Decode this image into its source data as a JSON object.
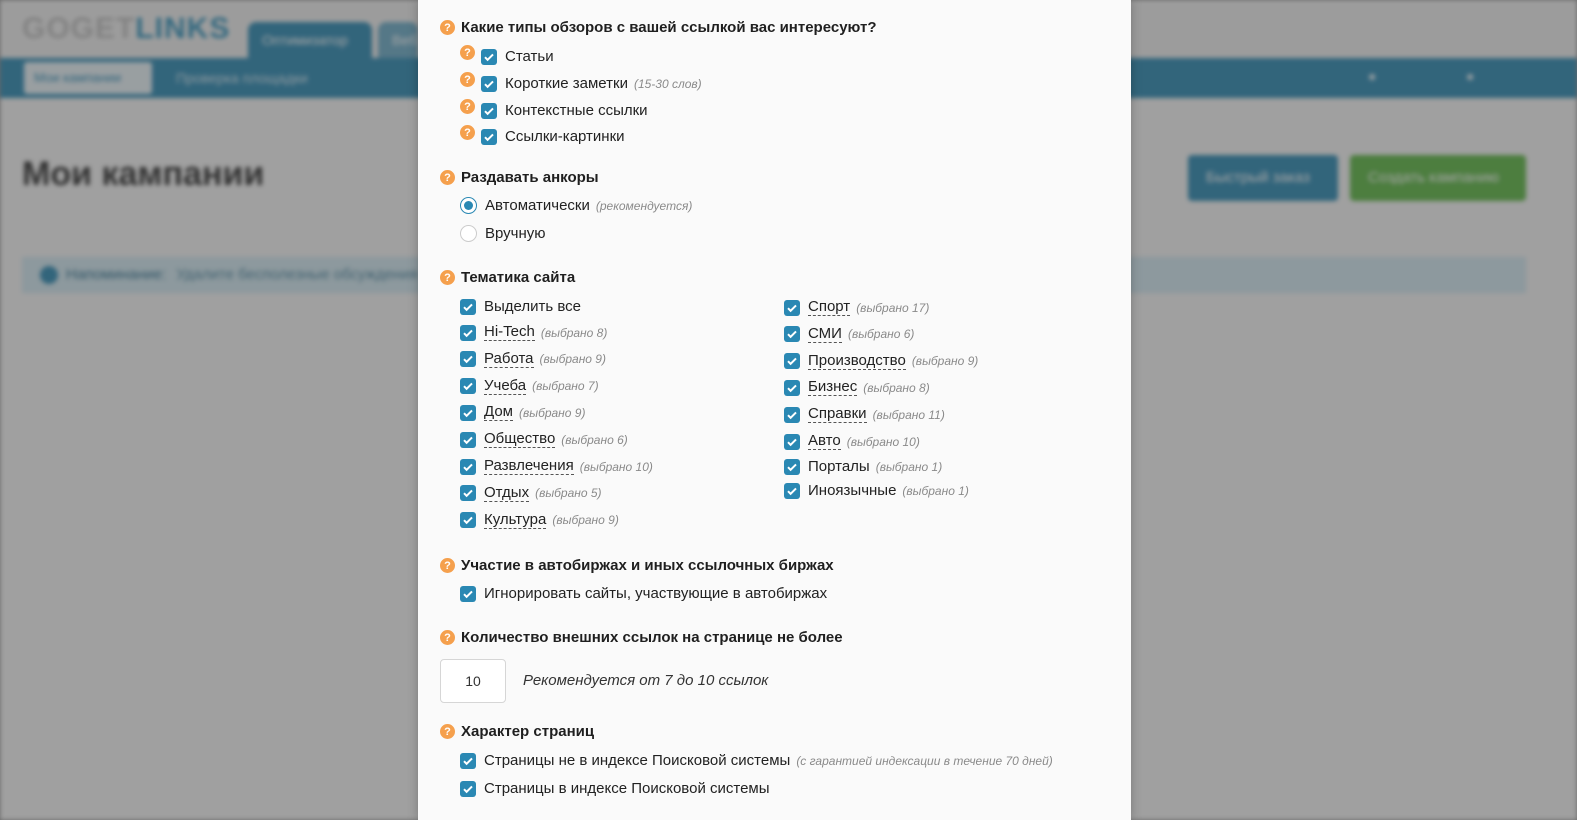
{
  "background": {
    "logo_pre": "GOGET",
    "logo_hl": "LINKS",
    "tab_active": "Оптимизатор",
    "tab_second": "Веб",
    "nav_button": "Мои кампании",
    "nav_link": "Проверка площадки",
    "page_title": "Мои кампании",
    "btn_fast": "Быстрый заказ",
    "btn_create": "Создать кампанию",
    "notice_label": "Напоминание:",
    "notice_text": "Удалите бесполезные обсуждения"
  },
  "modal": {
    "review_types": {
      "title": "Какие типы обзоров с вашей ссылкой вас интересуют?",
      "items": [
        {
          "label": "Статьи",
          "note": ""
        },
        {
          "label": "Короткие заметки",
          "note": "(15-30 слов)"
        },
        {
          "label": "Контекстные ссылки",
          "note": ""
        },
        {
          "label": "Ссылки-картинки",
          "note": ""
        }
      ]
    },
    "anchors": {
      "title": "Раздавать анкоры",
      "auto_label": "Автоматически",
      "auto_note": "(рекомендуется)",
      "manual_label": "Вручную"
    },
    "topics": {
      "title": "Тематика сайта",
      "select_all": "Выделить все",
      "left": [
        {
          "label": "Hi-Tech",
          "note": "(выбрано 8)"
        },
        {
          "label": "Работа",
          "note": "(выбрано 9)"
        },
        {
          "label": "Учеба",
          "note": "(выбрано 7)"
        },
        {
          "label": "Дом",
          "note": "(выбрано 9)"
        },
        {
          "label": "Общество",
          "note": "(выбрано 6)"
        },
        {
          "label": "Развлечения",
          "note": "(выбрано 10)"
        },
        {
          "label": "Отдых",
          "note": "(выбрано 5)"
        },
        {
          "label": "Культура",
          "note": "(выбрано 9)"
        }
      ],
      "right": [
        {
          "label": "Спорт",
          "note": "(выбрано 17)"
        },
        {
          "label": "СМИ",
          "note": "(выбрано 6)"
        },
        {
          "label": "Производство",
          "note": "(выбрано 9)"
        },
        {
          "label": "Бизнес",
          "note": "(выбрано 8)"
        },
        {
          "label": "Справки",
          "note": "(выбрано 11)"
        },
        {
          "label": "Авто",
          "note": "(выбрано 10)"
        },
        {
          "label": "Порталы",
          "note": "(выбрано 1)"
        },
        {
          "label": "Иноязычные",
          "note": "(выбрано 1)"
        }
      ]
    },
    "exchanges": {
      "title": "Участие в автобиржах и иных ссылочных биржах",
      "option": "Игнорировать сайты, участвующие в автобиржах"
    },
    "external_links": {
      "title": "Количество внешних ссылок на странице не более",
      "value": "10",
      "hint": "Рекомендуется от 7 до 10 ссылок"
    },
    "page_nature": {
      "title": "Характер страниц",
      "not_indexed": "Страницы не в индексе Поисковой системы",
      "not_indexed_note": "(с гарантией индексации в течение 70 дней)",
      "indexed": "Страницы в индексе Поисковой системы"
    }
  },
  "colors": {
    "accent": "#2a88b3",
    "help": "#f5a04d",
    "green": "#5bb443"
  }
}
